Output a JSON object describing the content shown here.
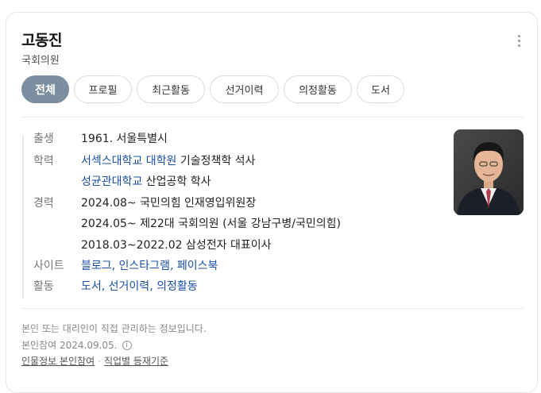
{
  "profile": {
    "name": "고동진",
    "subtitle": "국회의원"
  },
  "tabs": [
    {
      "label": "전체",
      "active": true
    },
    {
      "label": "프로필",
      "active": false
    },
    {
      "label": "최근활동",
      "active": false
    },
    {
      "label": "선거이력",
      "active": false
    },
    {
      "label": "의정활동",
      "active": false
    },
    {
      "label": "도서",
      "active": false
    }
  ],
  "info": {
    "birth_label": "출생",
    "birth_value": "1961. 서울특별시",
    "edu_label": "학력",
    "edu1_link": "서섹스대학교 대학원",
    "edu1_rest": "기술정책학 석사",
    "edu2_link": "성균관대학교",
    "edu2_rest": "산업공학 학사",
    "career_label": "경력",
    "career1": "2024.08~ 국민의힘 인재영입위원장",
    "career2": "2024.05~ 제22대 국회의원 (서울 강남구병/국민의힘)",
    "career3": "2018.03~2022.02 삼성전자 대표이사",
    "site_label": "사이트",
    "site1": "블로그",
    "site2": "인스타그램",
    "site3": "페이스북",
    "activity_label": "활동",
    "act1": "도서",
    "act2": "선거이력",
    "act3": "의정활동",
    "comma": ", "
  },
  "footer": {
    "note": "본인 또는 대리인이 직접 관리하는 정보입니다.",
    "date": "본인참여 2024.09.05.",
    "info_icon": "i",
    "link1": "인물정보 본인참여",
    "dot": "·",
    "link2": "직업별 등재기준"
  },
  "colors": {
    "active_tab": "#7c8fa0",
    "link": "#1a4fa8"
  }
}
